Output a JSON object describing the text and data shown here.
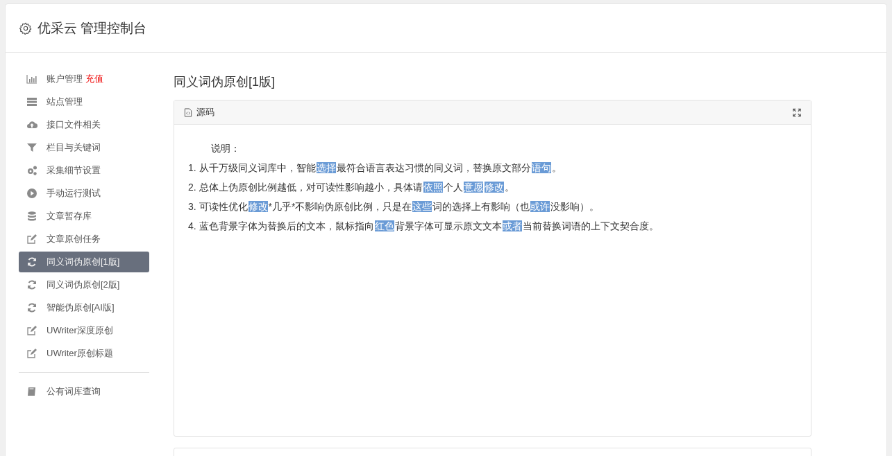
{
  "header": {
    "title": "优采云 管理控制台"
  },
  "sidebar": {
    "groups": [
      [
        {
          "kind": "chart",
          "label": "账户管理",
          "badge": "充值",
          "selected": false
        },
        {
          "kind": "server",
          "label": "站点管理",
          "selected": false
        },
        {
          "kind": "upload",
          "label": "接口文件相关",
          "selected": false
        },
        {
          "kind": "filter",
          "label": "栏目与关键词",
          "selected": false
        },
        {
          "kind": "cogs",
          "label": "采集细节设置",
          "selected": false
        },
        {
          "kind": "play",
          "label": "手动运行测试",
          "selected": false
        },
        {
          "kind": "database",
          "label": "文章暂存库",
          "selected": false
        },
        {
          "kind": "edit",
          "label": "文章原创任务",
          "selected": false
        },
        {
          "kind": "sync",
          "label": "同义词伪原创[1版]",
          "selected": true
        },
        {
          "kind": "sync",
          "label": "同义词伪原创[2版]",
          "selected": false
        },
        {
          "kind": "sync",
          "label": "智能伪原创[AI版]",
          "selected": false
        },
        {
          "kind": "edit",
          "label": "UWriter深度原创",
          "selected": false
        },
        {
          "kind": "edit",
          "label": "UWriter原创标题",
          "selected": false
        }
      ],
      [
        {
          "kind": "book",
          "label": "公有词库查询",
          "selected": false
        }
      ]
    ]
  },
  "main": {
    "title": "同义词伪原创[1版]",
    "panel": {
      "title": "源码",
      "heading": "说明：",
      "lines": [
        [
          {
            "text": "1. 从千万级同义词库中，智能",
            "highlighted": false
          },
          {
            "text": "选择",
            "highlighted": true
          },
          {
            "text": "最符合语言表达习惯的同义词，替换原文部分",
            "highlighted": false
          },
          {
            "text": "语句",
            "highlighted": true
          },
          {
            "text": "。",
            "highlighted": false
          }
        ],
        [
          {
            "text": "2. 总体上伪原创比例越低，对可读性影响越小，具体请",
            "highlighted": false
          },
          {
            "text": "依照",
            "highlighted": true
          },
          {
            "text": "个人",
            "highlighted": false
          },
          {
            "text": "意愿",
            "highlighted": true
          },
          {
            "text": "修改",
            "highlighted": true
          },
          {
            "text": "。",
            "highlighted": false
          }
        ],
        [
          {
            "text": "3. 可读性优化",
            "highlighted": false
          },
          {
            "text": "修改",
            "highlighted": true
          },
          {
            "text": "*几乎*不影响伪原创比例，只是在",
            "highlighted": false
          },
          {
            "text": "这些",
            "highlighted": true
          },
          {
            "text": "词的选择上有影响（也",
            "highlighted": false
          },
          {
            "text": "或许",
            "highlighted": true
          },
          {
            "text": "没影响）。",
            "highlighted": false
          }
        ],
        [
          {
            "text": "4. 蓝色背景字体为替换后的文本，鼠标指向",
            "highlighted": false
          },
          {
            "text": "红色",
            "highlighted": true
          },
          {
            "text": "背景字体可显示原文文本",
            "highlighted": false
          },
          {
            "text": "或者",
            "highlighted": true
          },
          {
            "text": "当前替换词语的上下文契合度。",
            "highlighted": false
          }
        ]
      ]
    }
  }
}
